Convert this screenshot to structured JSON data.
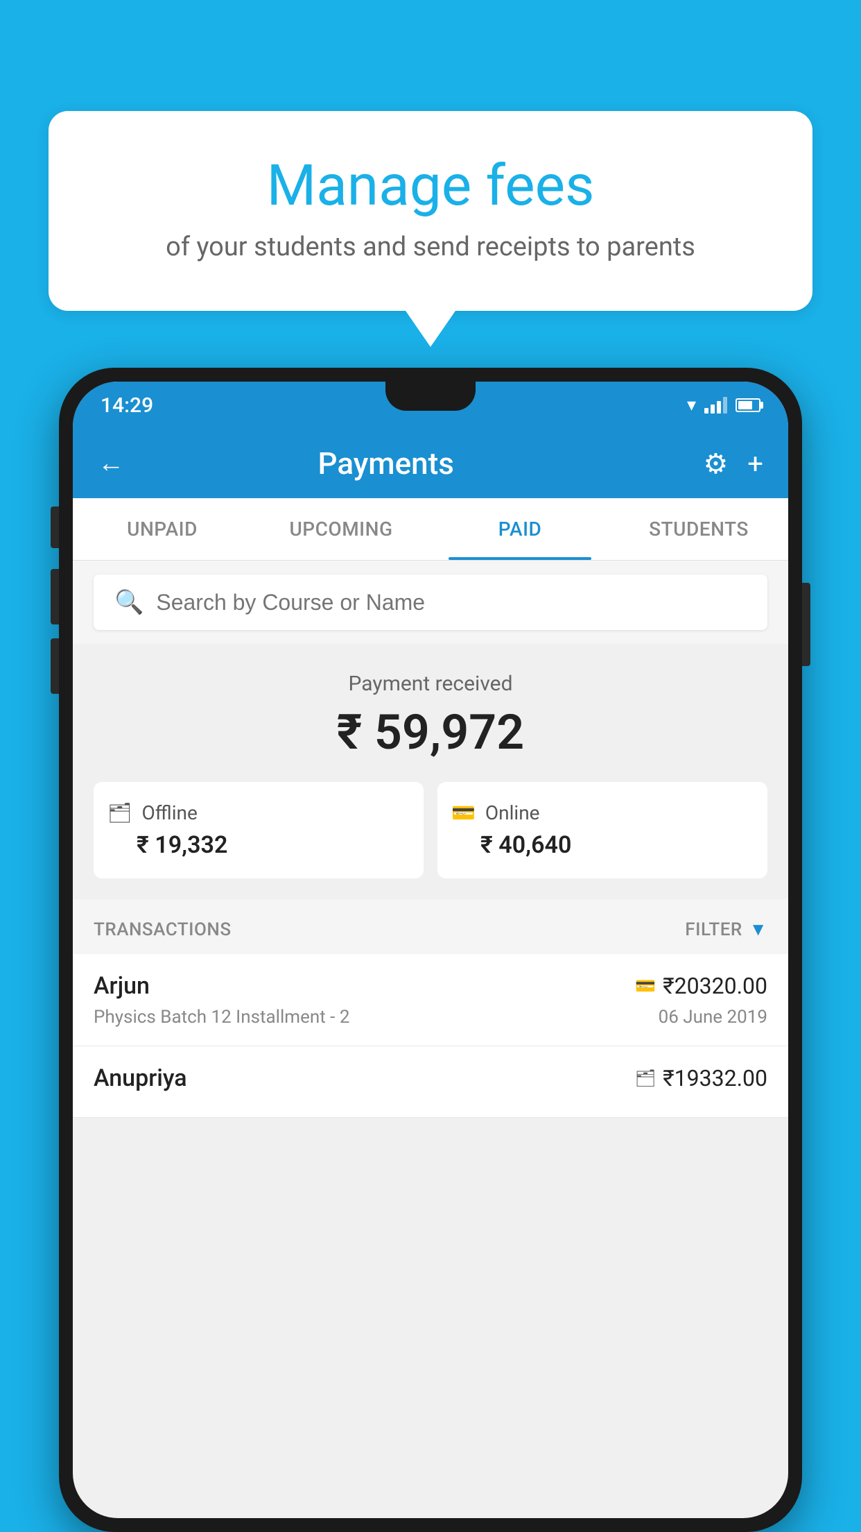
{
  "background_color": "#1ab0e8",
  "speech_bubble": {
    "title": "Manage fees",
    "subtitle": "of your students and send receipts to parents"
  },
  "status_bar": {
    "time": "14:29"
  },
  "header": {
    "title": "Payments",
    "back_label": "←",
    "settings_label": "⚙",
    "add_label": "+"
  },
  "tabs": [
    {
      "label": "UNPAID",
      "active": false
    },
    {
      "label": "UPCOMING",
      "active": false
    },
    {
      "label": "PAID",
      "active": true
    },
    {
      "label": "STUDENTS",
      "active": false
    }
  ],
  "search": {
    "placeholder": "Search by Course or Name"
  },
  "payment_section": {
    "label": "Payment received",
    "total_amount": "₹ 59,972",
    "offline": {
      "type": "Offline",
      "amount": "₹ 19,332"
    },
    "online": {
      "type": "Online",
      "amount": "₹ 40,640"
    }
  },
  "transactions": {
    "section_label": "TRANSACTIONS",
    "filter_label": "FILTER",
    "items": [
      {
        "name": "Arjun",
        "course": "Physics Batch 12 Installment - 2",
        "amount": "₹20320.00",
        "date": "06 June 2019",
        "payment_type": "online"
      },
      {
        "name": "Anupriya",
        "course": "",
        "amount": "₹19332.00",
        "date": "",
        "payment_type": "offline"
      }
    ]
  }
}
